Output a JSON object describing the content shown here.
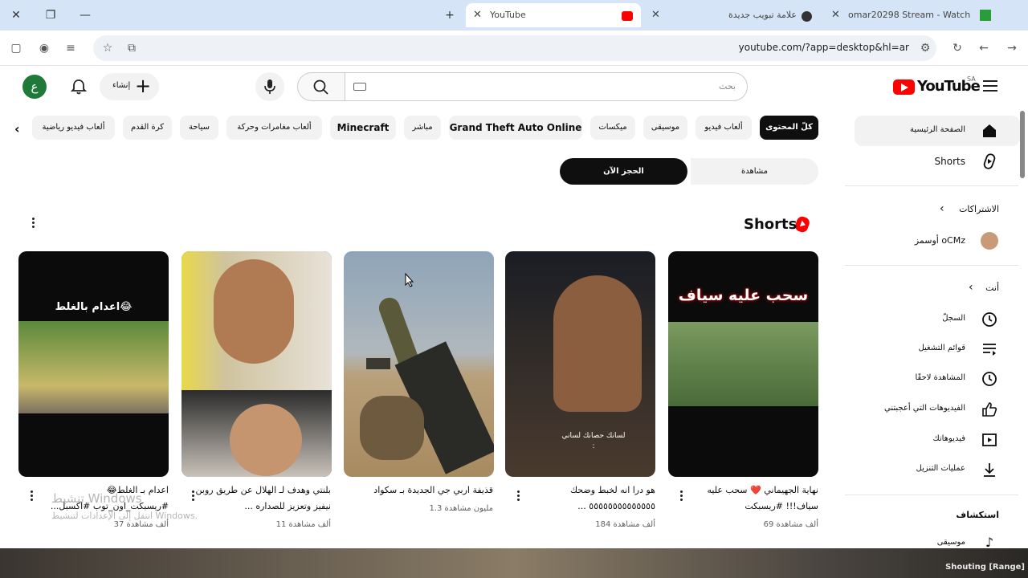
{
  "browser": {
    "tabs": [
      {
        "title": "YouTube",
        "active": true
      },
      {
        "title": "علامة تبويب جديدة",
        "active": false
      },
      {
        "title": "omar20298 Stream - Watch",
        "active": false
      }
    ],
    "url": "youtube.com/?app=desktop&hl=ar"
  },
  "header": {
    "avatar_letter": "ع",
    "create_label": "إنشاء",
    "search_placeholder": "بحث",
    "logo_text": "YouTube",
    "country_code": "SA"
  },
  "chips": [
    {
      "label": "كلّ المحتوى",
      "active": true
    },
    {
      "label": "ألعاب فيديو"
    },
    {
      "label": "موسيقى"
    },
    {
      "label": "ميكسات"
    },
    {
      "label": "Grand Theft Auto Online"
    },
    {
      "label": "مباشر"
    },
    {
      "label": "Minecraft"
    },
    {
      "label": "ألعاب مغامرات وحركة"
    },
    {
      "label": "سياحة"
    },
    {
      "label": "كرة القدم"
    },
    {
      "label": "ألعاب فيديو رياضية"
    }
  ],
  "booking": {
    "watch_label": "مشاهدة",
    "book_label": "الحجز الآن"
  },
  "shorts": {
    "heading": "Shorts",
    "items": [
      {
        "overlay": "سحب عليه سياف",
        "title": "نهاية الجهيماني ❤️ سحب عليه سياف!!! #ريسبكت",
        "views": "69 ألف مشاهدة",
        "colors": [
          "#0b0b0b",
          "#5f7d4a"
        ]
      },
      {
        "overlay": "لسانك حصانك لساني :",
        "title": "هو درا انه لخبط وضحك ٥٥٥٥٥٥٥٥٥٥٥٥٥٥ ...",
        "views": "184 ألف مشاهدة",
        "colors": [
          "#1a1d24",
          "#4a3a2e"
        ]
      },
      {
        "overlay": "",
        "title": "قذيفة اربي جي الجديدة بـ سكواد",
        "views": "1.3 مليون مشاهدة",
        "colors": [
          "#8ea4b8",
          "#b8a07a"
        ]
      },
      {
        "overlay": "",
        "title": "بلنتي وهدف لـ الهلال عن طريق روبن نيفيز وتعزيز للصداره ...",
        "views": "11 ألف مشاهدة",
        "colors": [
          "#e8d84a",
          "#2b2b2b"
        ]
      },
      {
        "overlay": "اعدام بالغلط😂",
        "title": "اعدام بـ الغلط😂 #ريسبكت_اون_توب #اكسبل...",
        "views": "37 ألف مشاهدة",
        "colors": [
          "#0b0b0b",
          "#5a8a3a"
        ]
      }
    ]
  },
  "sidebar": {
    "top": [
      {
        "label": "الصفحة الرئيسية",
        "icon": "home-icon",
        "selected": true
      },
      {
        "label": "Shorts",
        "icon": "shorts-icon"
      }
    ],
    "subs_heading": "الاشتراكات",
    "subs": [
      {
        "label": "أوسمز oCMz",
        "icon": "channel-avatar"
      }
    ],
    "you_heading": "أنت",
    "you": [
      {
        "label": "السجلّ",
        "icon": "history-icon"
      },
      {
        "label": "قوائم التشغيل",
        "icon": "playlist-icon"
      },
      {
        "label": "المشاهدة لاحقًا",
        "icon": "clock-icon"
      },
      {
        "label": "الفيديوهات التي أعجبتني",
        "icon": "like-icon"
      },
      {
        "label": "فيديوهاتك",
        "icon": "video-icon"
      },
      {
        "label": "عمليات التنزيل",
        "icon": "download-icon"
      }
    ],
    "explore_heading": "استكشاف",
    "explore": [
      {
        "label": "موسيقى",
        "icon": "music-icon"
      }
    ]
  },
  "overlay": {
    "watermark_title": "تنشيط Windows",
    "watermark_sub": "انتقل إلى الإعدادات لتنشيط Windows.",
    "game_caption": "Shouting [Range]"
  }
}
